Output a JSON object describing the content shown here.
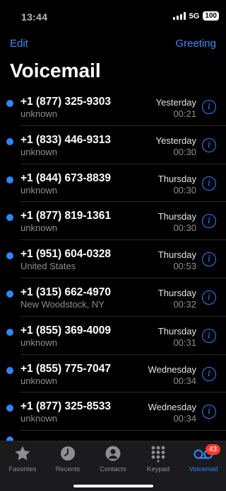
{
  "status": {
    "time": "13:44",
    "network": "5G",
    "battery": "100"
  },
  "nav": {
    "edit": "Edit",
    "greeting": "Greeting"
  },
  "title": "Voicemail",
  "voicemails": [
    {
      "number": "+1 (877) 325-9303",
      "location": "unknown",
      "day": "Yesterday",
      "duration": "00:21"
    },
    {
      "number": "+1 (833) 446-9313",
      "location": "unknown",
      "day": "Yesterday",
      "duration": "00:30"
    },
    {
      "number": "+1 (844) 673-8839",
      "location": "unknown",
      "day": "Thursday",
      "duration": "00:30"
    },
    {
      "number": "+1 (877) 819-1361",
      "location": "unknown",
      "day": "Thursday",
      "duration": "00:30"
    },
    {
      "number": "+1 (951) 604-0328",
      "location": "United States",
      "day": "Thursday",
      "duration": "00:53"
    },
    {
      "number": "+1 (315) 662-4970",
      "location": "New Woodstock, NY",
      "day": "Thursday",
      "duration": "00:32"
    },
    {
      "number": "+1 (855) 369-4009",
      "location": "unknown",
      "day": "Thursday",
      "duration": "00:31"
    },
    {
      "number": "+1 (855) 775-7047",
      "location": "unknown",
      "day": "Wednesday",
      "duration": "00:34"
    },
    {
      "number": "+1 (877) 325-8533",
      "location": "unknown",
      "day": "Wednesday",
      "duration": "00:34"
    }
  ],
  "tabs": [
    {
      "label": "Favorites",
      "icon": "star-icon"
    },
    {
      "label": "Recents",
      "icon": "clock-icon"
    },
    {
      "label": "Contacts",
      "icon": "person-icon"
    },
    {
      "label": "Keypad",
      "icon": "keypad-icon"
    },
    {
      "label": "Voicemail",
      "icon": "voicemail-icon",
      "badge": "43"
    }
  ],
  "colors": {
    "accent": "#2f86f6",
    "unread_dot": "#2f86f6",
    "badge": "#ff3b30"
  }
}
